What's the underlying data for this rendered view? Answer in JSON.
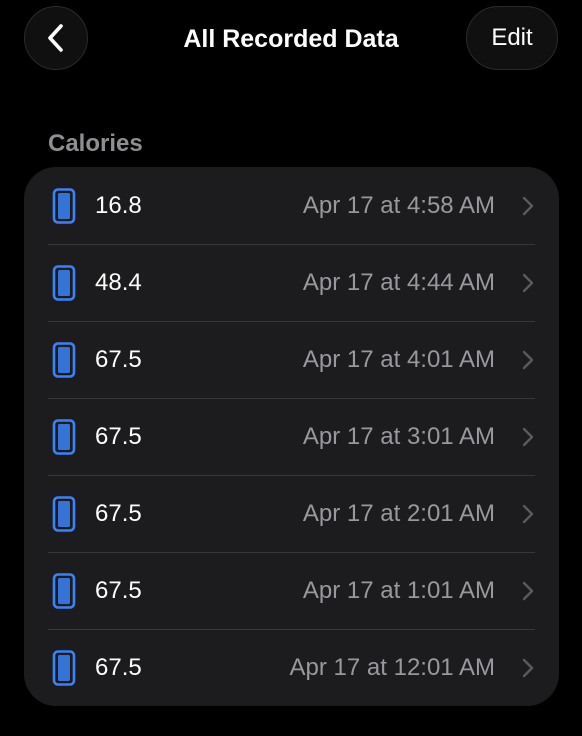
{
  "nav": {
    "title": "All Recorded Data",
    "edit_label": "Edit",
    "back_icon": "chevron-left-icon"
  },
  "section": {
    "header": "Calories"
  },
  "colors": {
    "background": "#000000",
    "card": "#1c1c1e",
    "icon_blue": "#3a82f7",
    "secondary_text": "#98989d"
  },
  "rows": [
    {
      "value": "16.8",
      "date": "Apr 17 at 4:58 AM",
      "icon": "iphone-icon"
    },
    {
      "value": "48.4",
      "date": "Apr 17 at 4:44 AM",
      "icon": "iphone-icon"
    },
    {
      "value": "67.5",
      "date": "Apr 17 at 4:01 AM",
      "icon": "iphone-icon"
    },
    {
      "value": "67.5",
      "date": "Apr 17 at 3:01 AM",
      "icon": "iphone-icon"
    },
    {
      "value": "67.5",
      "date": "Apr 17 at 2:01 AM",
      "icon": "iphone-icon"
    },
    {
      "value": "67.5",
      "date": "Apr 17 at 1:01 AM",
      "icon": "iphone-icon"
    },
    {
      "value": "67.5",
      "date": "Apr 17 at 12:01 AM",
      "icon": "iphone-icon"
    }
  ]
}
